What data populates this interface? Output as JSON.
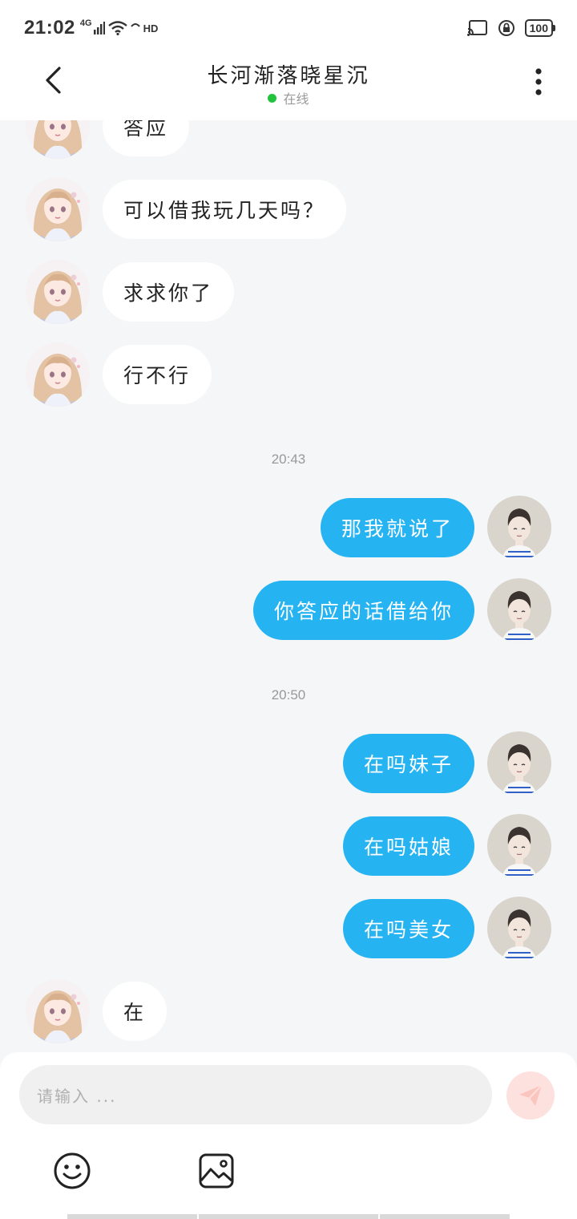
{
  "status_bar": {
    "time": "21:02",
    "network": "4G",
    "hd": "HD",
    "battery": "100"
  },
  "header": {
    "title": "长河渐落晓星沉",
    "status": "在线"
  },
  "messages": [
    {
      "side": "left",
      "text": "答应"
    },
    {
      "side": "left",
      "text": "可以借我玩几天吗？"
    },
    {
      "side": "left",
      "text": "求求你了"
    },
    {
      "side": "left",
      "text": "行不行"
    },
    {
      "timestamp": "20:43"
    },
    {
      "side": "right",
      "text": "那我就说了"
    },
    {
      "side": "right",
      "text": "你答应的话借给你"
    },
    {
      "timestamp": "20:50"
    },
    {
      "side": "right",
      "text": "在吗妹子"
    },
    {
      "side": "right",
      "text": "在吗姑娘"
    },
    {
      "side": "right",
      "text": "在吗美女"
    },
    {
      "side": "left",
      "text": "在"
    }
  ],
  "input": {
    "placeholder": "请输入 ..."
  },
  "icons": {
    "back": "chevron-left-icon",
    "more": "more-vertical-icon",
    "send": "send-icon",
    "emoji": "emoji-icon",
    "image": "image-icon"
  },
  "colors": {
    "outgoing_bubble": "#26b3f2",
    "incoming_bubble": "#ffffff",
    "background": "#f4f6f7",
    "online": "#22c33d",
    "send_button": "#fde1de"
  }
}
